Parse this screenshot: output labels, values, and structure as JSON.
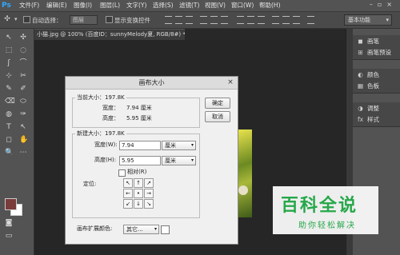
{
  "app": {
    "logo": "Ps"
  },
  "menu": [
    "文件(F)",
    "编辑(E)",
    "图像(I)",
    "图层(L)",
    "文字(Y)",
    "选择(S)",
    "滤镜(T)",
    "视图(V)",
    "窗口(W)",
    "帮助(H)"
  ],
  "window_controls": "–▫×",
  "options": {
    "auto_select_label": "自动选择：",
    "auto_select_value": "图层",
    "show_transform_label": "显示变换控件",
    "workspace": "基本功能"
  },
  "document_tab": "小猫.jpg @ 100% (百度ID：sunnyMelody夏, RGB/8#) * ×",
  "tools": [
    "↖",
    "✣",
    "⬚",
    "◌",
    "ʃ",
    "⌒",
    "⊹",
    "✂",
    "✎",
    "✐",
    "⌫",
    "⬭",
    "◍",
    "✑",
    "T",
    "↖",
    "◻",
    "✋",
    "🔍",
    "⋯"
  ],
  "panels": {
    "group1": [
      {
        "icon": "◼",
        "label": "画笔"
      },
      {
        "icon": "⊞",
        "label": "画笔预设"
      }
    ],
    "group2": [
      {
        "icon": "◐",
        "label": "颜色"
      },
      {
        "icon": "▦",
        "label": "色板"
      }
    ],
    "group3": [
      {
        "icon": "◑",
        "label": "调整"
      },
      {
        "icon": "fx",
        "label": "样式"
      }
    ]
  },
  "dialog": {
    "title": "画布大小",
    "close": "×",
    "current_size_label": "当前大小：197.8K",
    "width_label": "宽度：",
    "width_value": "7.94 厘米",
    "height_label": "高度：",
    "height_value": "5.95 厘米",
    "ok_label": "确定",
    "cancel_label": "取消",
    "new_size_label": "新建大小：197.8K",
    "new_width_label": "宽度(W):",
    "new_width_value": "7.94",
    "new_width_unit": "厘米",
    "new_height_label": "高度(H):",
    "new_height_value": "5.95",
    "new_height_unit": "厘米",
    "relative_label": "相对(R)",
    "anchor_label": "定位:",
    "anchor_glyphs": [
      "↖",
      "↑",
      "↗",
      "←",
      "•",
      "→",
      "↙",
      "↓",
      "↘"
    ],
    "extension_color_label": "画布扩展颜色:",
    "extension_color_value": "其它..."
  },
  "watermark": {
    "main": "百科全说",
    "sub": "助你轻松解决"
  }
}
